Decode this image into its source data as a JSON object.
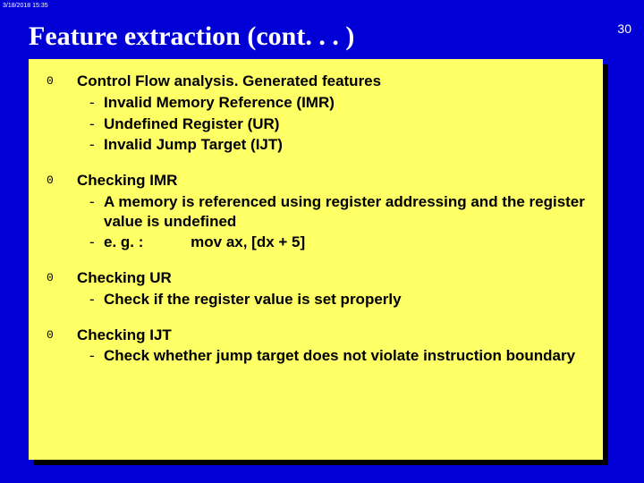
{
  "timestamp": "3/18/2018  15:35",
  "title": "Feature extraction (cont. . . )",
  "slide_number": "30",
  "bullets": [
    {
      "head": "Control Flow analysis. Generated features",
      "subs": [
        "Invalid Memory Reference (IMR)",
        "Undefined Register (UR)",
        "Invalid Jump Target (IJT)"
      ]
    },
    {
      "head": "Checking IMR",
      "subs": [
        "A memory is referenced using register addressing and the register value is undefined",
        {
          "prefix": "e. g. :",
          "code": "mov ax, [dx + 5]"
        }
      ]
    },
    {
      "head": "Checking UR",
      "subs": [
        "Check if the register value is set properly"
      ]
    },
    {
      "head": "Checking IJT",
      "subs": [
        "Check whether jump target does not violate instruction boundary"
      ]
    }
  ],
  "glyphs": {
    "o": "0",
    "dash": "-"
  }
}
